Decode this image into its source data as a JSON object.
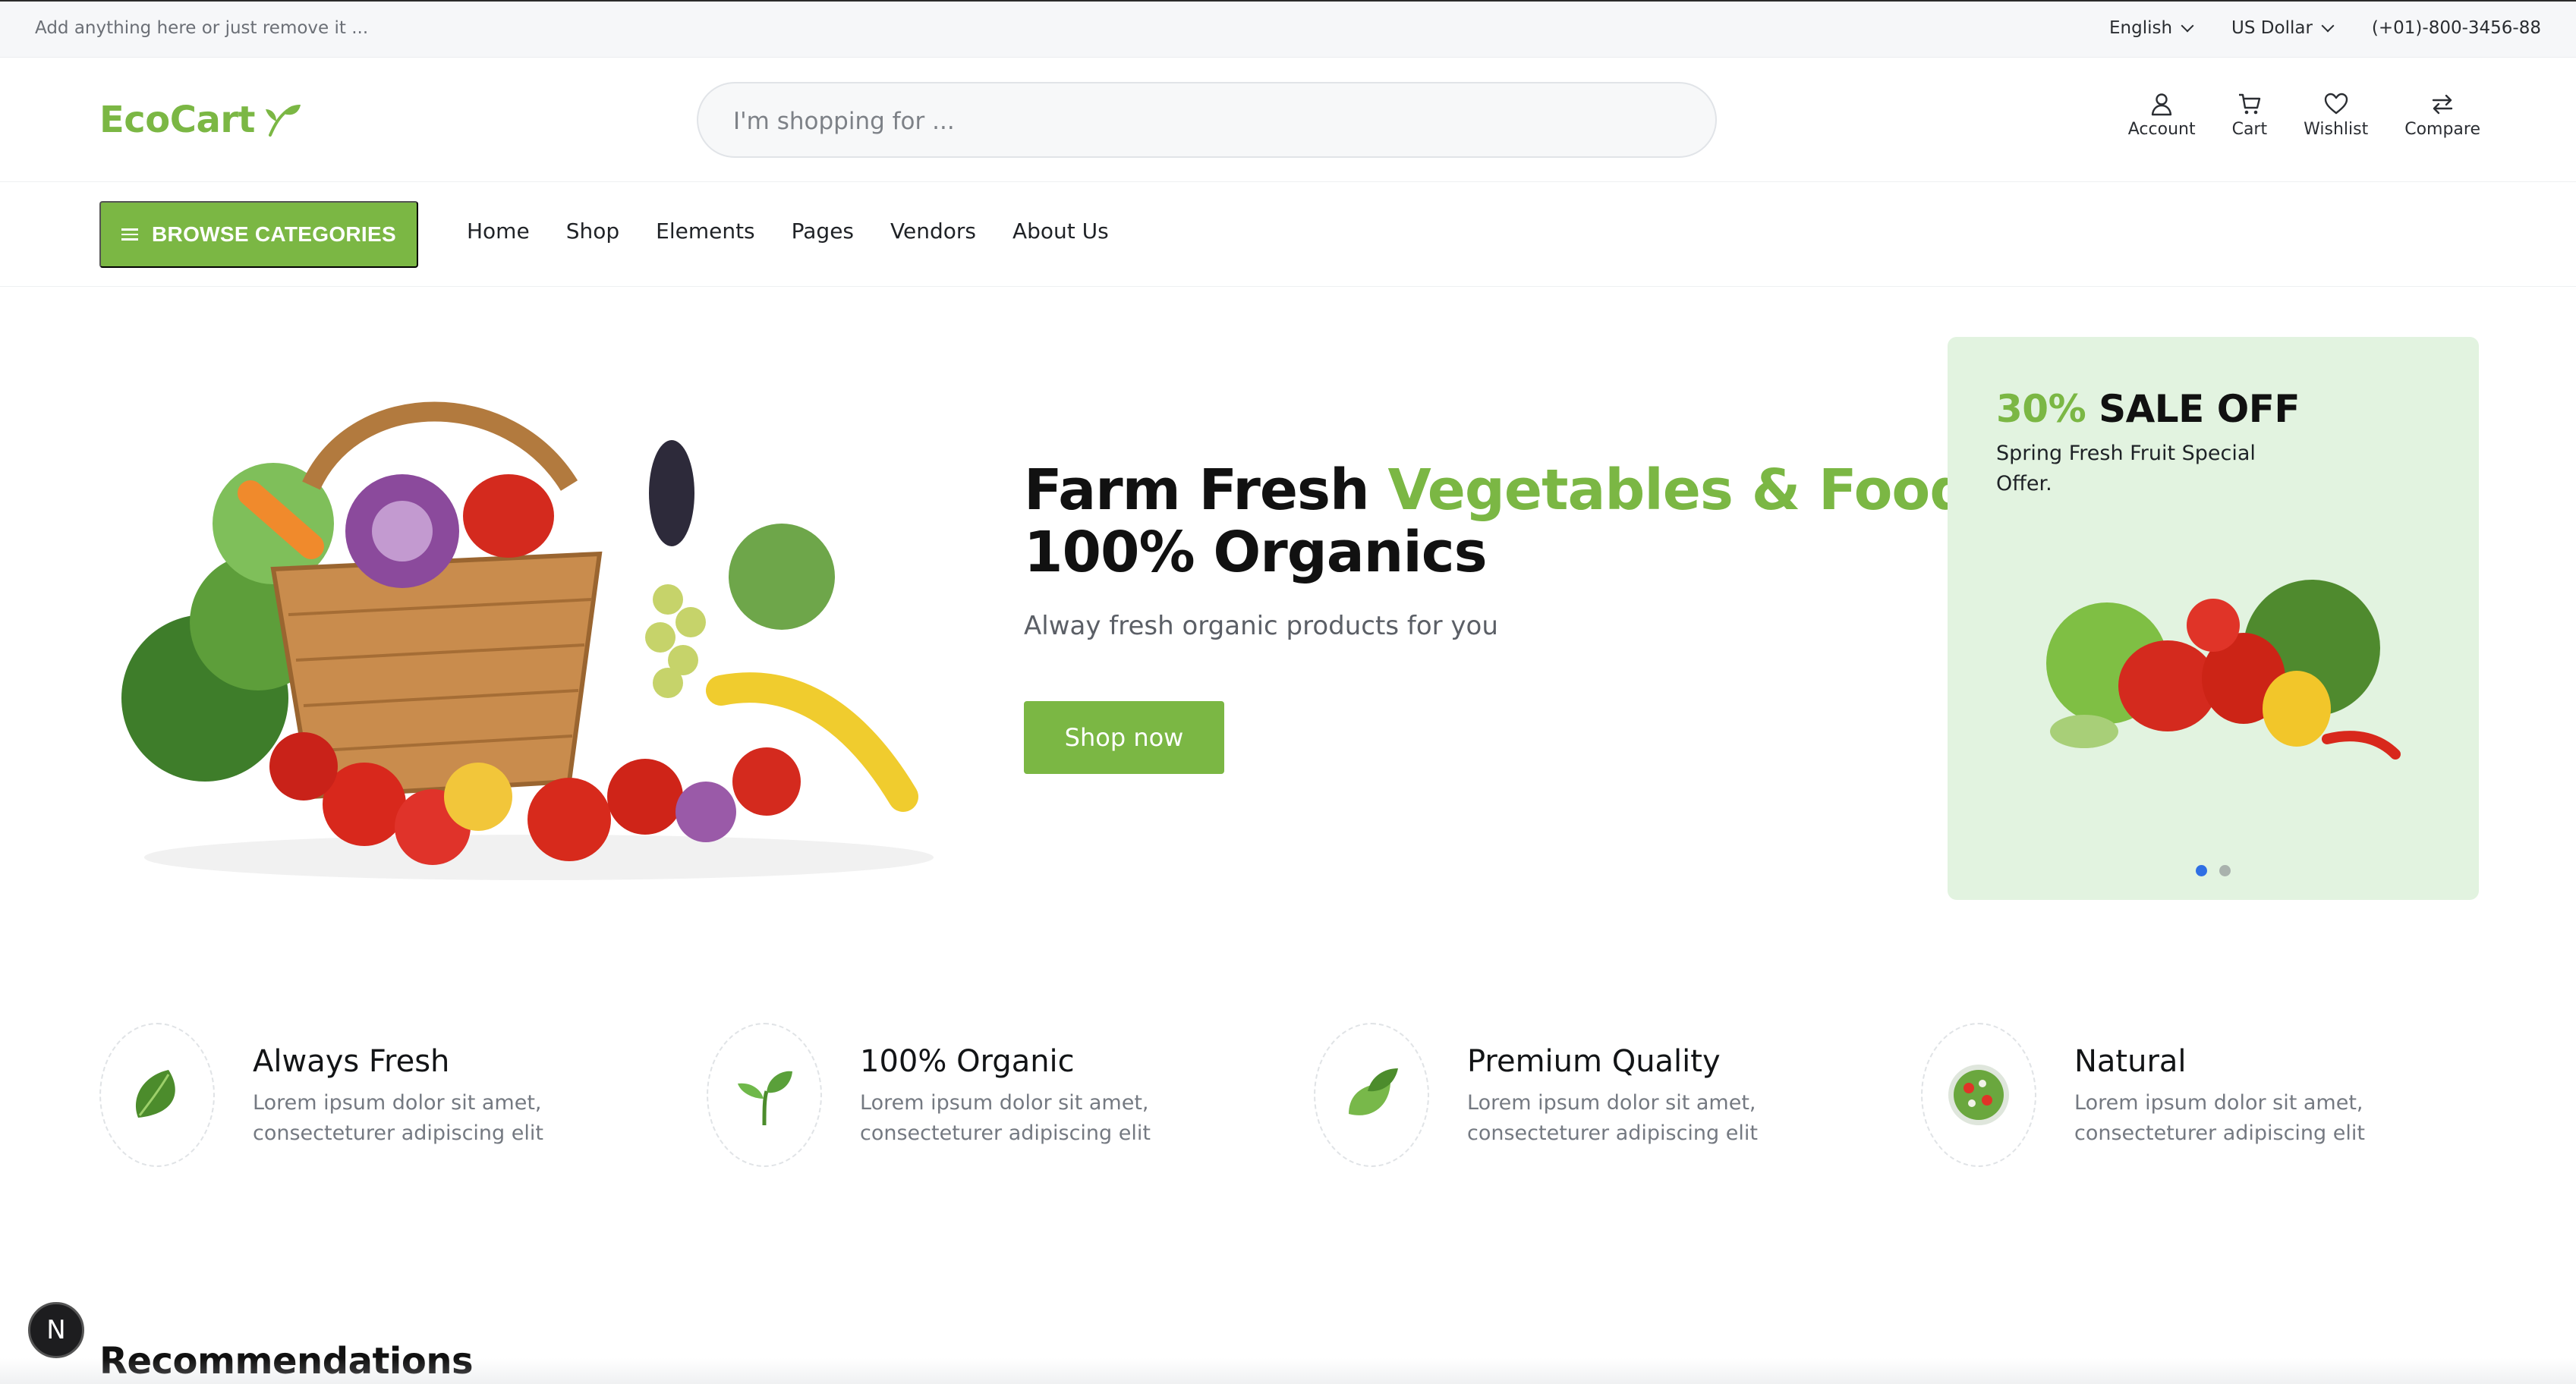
{
  "topbar": {
    "announcement": "Add anything here or just remove it ...",
    "language": "English",
    "currency": "US Dollar",
    "phone": "(+01)-800-3456-88"
  },
  "header": {
    "logo_text": "EcoCart",
    "search_placeholder": "I'm shopping for ...",
    "icons": [
      {
        "label": "Account",
        "icon": "user-icon"
      },
      {
        "label": "Cart",
        "icon": "cart-icon"
      },
      {
        "label": "Wishlist",
        "icon": "heart-icon"
      },
      {
        "label": "Compare",
        "icon": "compare-icon"
      }
    ]
  },
  "nav": {
    "browse_label": "BROWSE CATEGORIES",
    "links": [
      "Home",
      "Shop",
      "Elements",
      "Pages",
      "Vendors",
      "About Us"
    ]
  },
  "hero": {
    "title_part1": "Farm Fresh ",
    "title_green": "Vegetables & Food",
    "title_line2": "100% Organics",
    "subtitle": "Alway fresh organic products for you",
    "cta": "Shop now"
  },
  "promo": {
    "percent": "30%",
    "title_rest": " SALE OFF",
    "subtitle": "Spring Fresh Fruit Special Offer.",
    "slides": 2,
    "active_slide": 1
  },
  "features": [
    {
      "title": "Always Fresh",
      "desc": "Lorem ipsum dolor sit amet, consecteturer adipiscing elit",
      "icon": "leafy-green-icon"
    },
    {
      "title": "100% Organic",
      "desc": "Lorem ipsum dolor sit amet, consecteturer adipiscing elit",
      "icon": "sprout-icon"
    },
    {
      "title": "Premium Quality",
      "desc": "Lorem ipsum dolor sit amet, consecteturer adipiscing elit",
      "icon": "leaves-icon"
    },
    {
      "title": "Natural",
      "desc": "Lorem ipsum dolor sit amet, consecteturer adipiscing elit",
      "icon": "salad-bowl-icon"
    }
  ],
  "recommendations_heading": "Recommendations",
  "badge_letter": "N",
  "colors": {
    "brand_green": "#7bb744",
    "promo_bg": "#e2f3e0",
    "dot_active": "#2f6fe4"
  }
}
